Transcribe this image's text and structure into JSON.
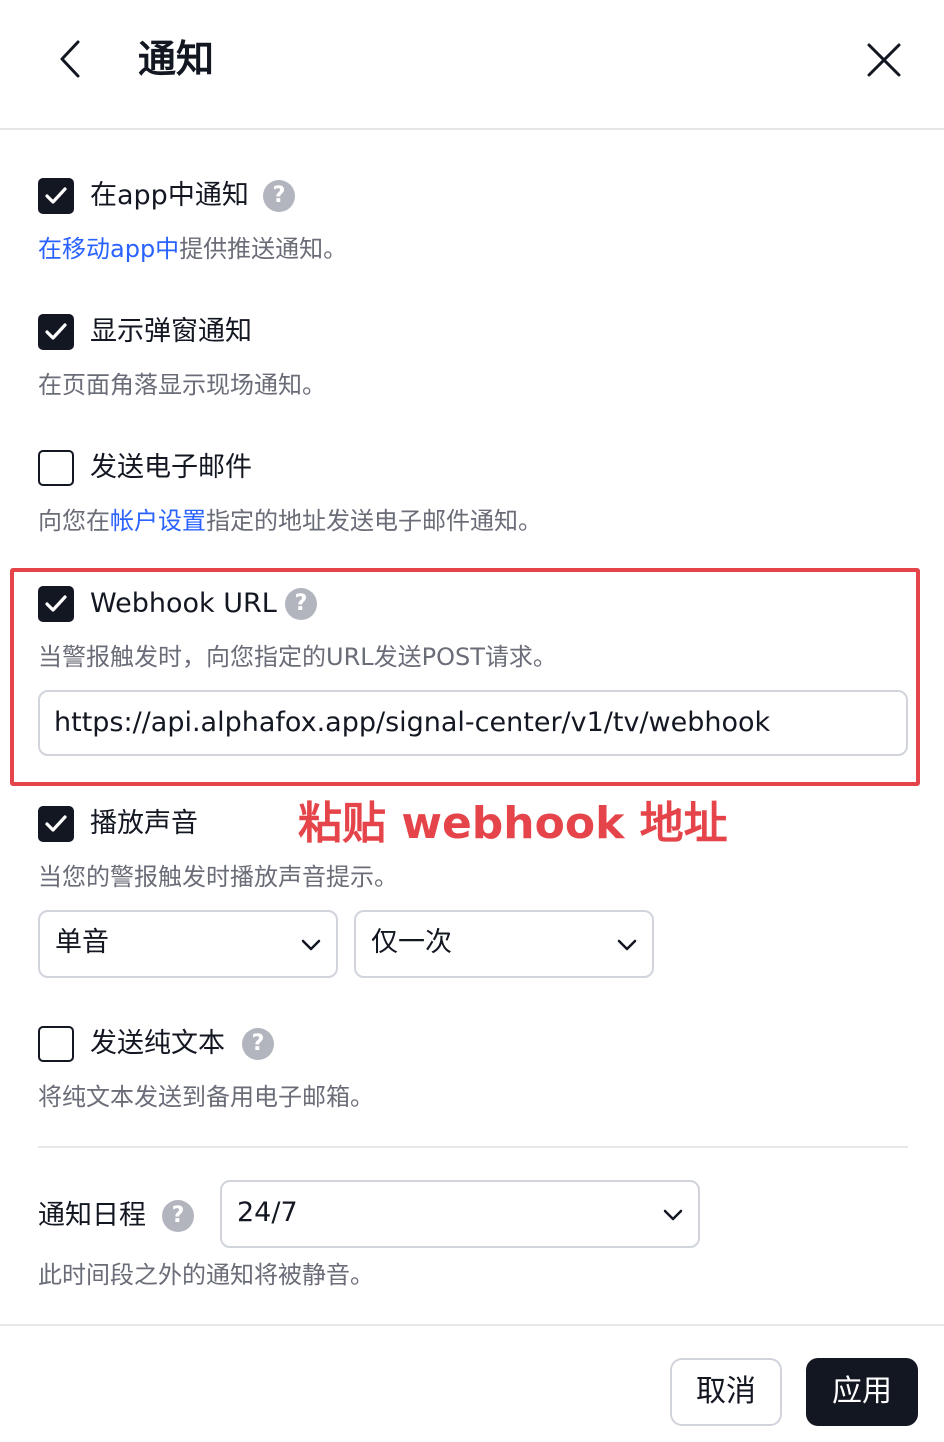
{
  "header": {
    "title": "通知",
    "back_icon": "chevron-left-icon",
    "close_icon": "close-icon"
  },
  "options": {
    "app": {
      "label": "在app中通知",
      "checked": true,
      "desc_link": "在移动app中",
      "desc_rest": "提供推送通知。"
    },
    "popup": {
      "label": "显示弹窗通知",
      "checked": true,
      "desc": "在页面角落显示现场通知。"
    },
    "email": {
      "label": "发送电子邮件",
      "checked": false,
      "desc_pre": "向您在",
      "desc_link": "帐户设置",
      "desc_post": "指定的地址发送电子邮件通知。"
    },
    "webhook": {
      "label": "Webhook URL",
      "checked": true,
      "desc": "当警报触发时，向您指定的URL发送POST请求。",
      "url_value": "https://api.alphafox.app/signal-center/v1/tv/webhook"
    },
    "sound": {
      "label": "播放声音",
      "checked": true,
      "desc": "当您的警报触发时播放声音提示。",
      "sound_select": "单音",
      "repeat_select": "仅一次"
    },
    "plaintext": {
      "label": "发送纯文本",
      "checked": false,
      "desc": "将纯文本发送到备用电子邮箱。"
    }
  },
  "schedule": {
    "label": "通知日程",
    "value": "24/7",
    "desc": "此时间段之外的通知将被静音。"
  },
  "annotation": "粘贴 webhook 地址",
  "footer": {
    "cancel_label": "取消",
    "apply_label": "应用"
  },
  "help_glyph": "?",
  "colors": {
    "accent_link": "#2962ff",
    "annotation_red": "#e5454a",
    "primary_dark": "#131722",
    "muted_text": "#6a6d78"
  }
}
